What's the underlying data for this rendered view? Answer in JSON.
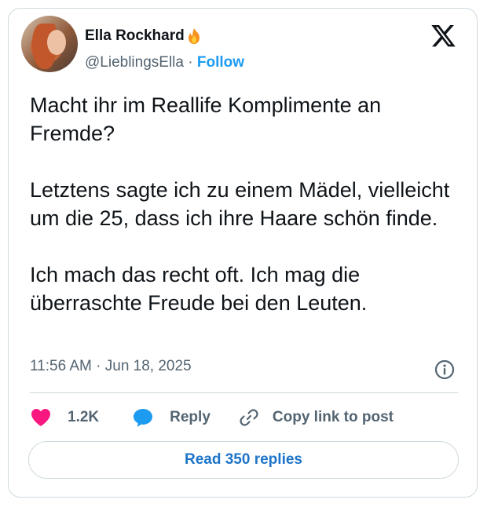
{
  "tweet": {
    "author": {
      "name": "Ella Rockhard",
      "name_emoji_icon": "fire-icon",
      "handle": "@LieblingsElla",
      "separator": "·",
      "follow_label": "Follow"
    },
    "brand_icon": "x-logo-icon",
    "text": "Macht ihr im Reallife Komplimente an Fremde?\n\nLetztens sagte ich zu einem Mädel, vielleicht um die 25, dass ich ihre Haare schön finde.\n\nIch mach das recht oft. Ich mag die überraschte Freude bei den Leuten.",
    "timestamp": "11:56 AM · Jun 18, 2025",
    "actions": {
      "like_count": "1.2K",
      "reply_label": "Reply",
      "copy_link_label": "Copy link to post"
    },
    "read_replies_label": "Read 350 replies"
  },
  "colors": {
    "accent": "#1d9bf0",
    "like": "#f91880",
    "text": "#0f1419",
    "secondary": "#536471",
    "border": "#cfd9de"
  }
}
